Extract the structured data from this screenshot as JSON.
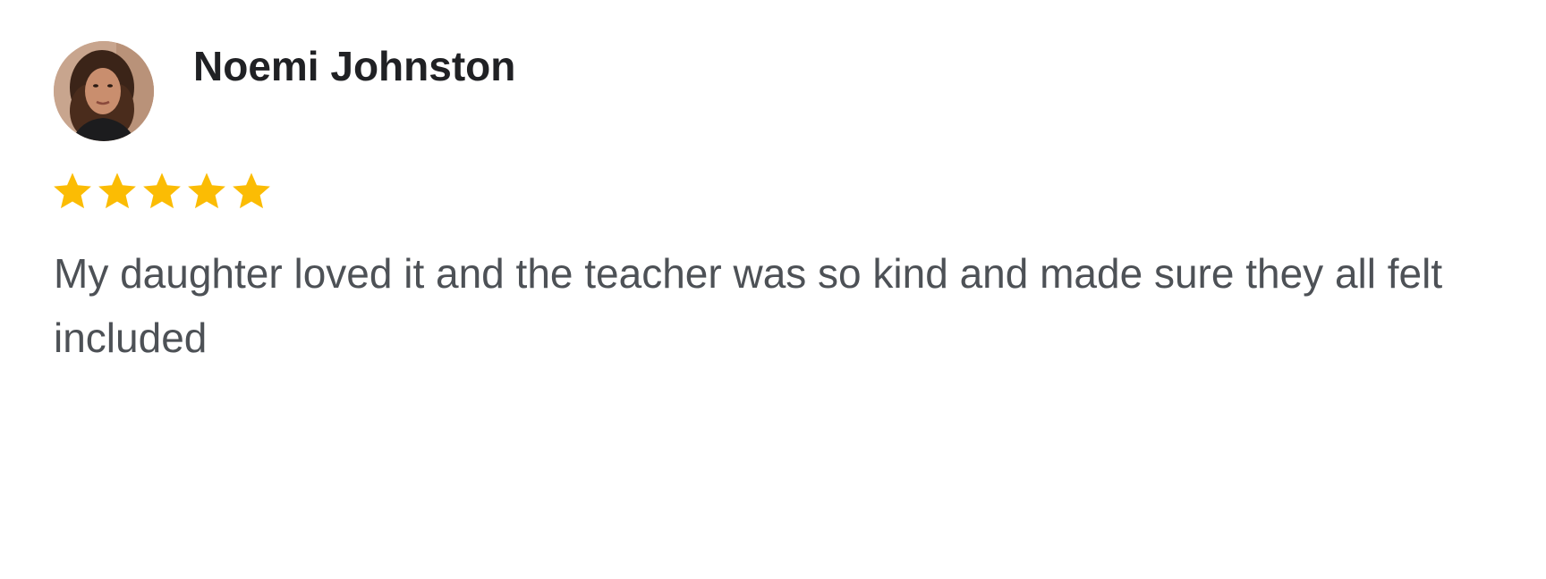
{
  "review": {
    "reviewer_name": "Noemi Johnston",
    "avatar_icon": "reviewer-avatar-photo",
    "rating": 5,
    "rating_max": 5,
    "star_icon": "star-icon",
    "star_color": "#FBBC04",
    "text": "My daughter loved it and the teacher was so kind and made sure they all felt included"
  },
  "colors": {
    "name": "#202124",
    "text": "#4D5156",
    "background": "#FFFFFF"
  }
}
